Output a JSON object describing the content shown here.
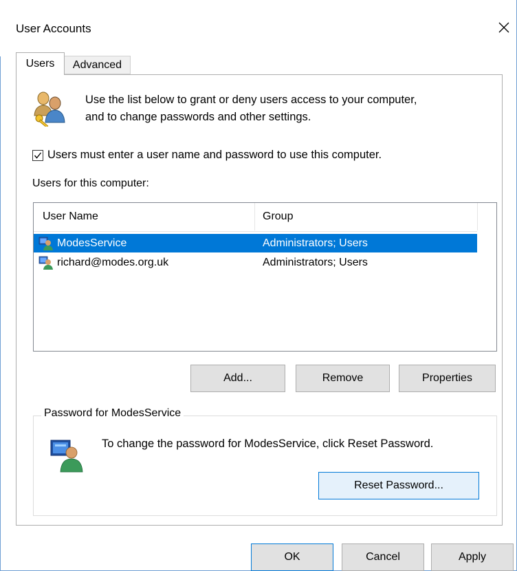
{
  "window": {
    "title": "User Accounts"
  },
  "tabs": [
    {
      "label": "Users",
      "active": true
    },
    {
      "label": "Advanced",
      "active": false
    }
  ],
  "intro": {
    "line1": "Use the list below to grant or deny users access to your computer,",
    "line2": "and to change passwords and other settings."
  },
  "require_login": {
    "label": "Users must enter a user name and password to use this computer.",
    "checked": true
  },
  "users_list": {
    "label": "Users for this computer:",
    "columns": [
      "User Name",
      "Group"
    ],
    "rows": [
      {
        "name": "ModesService",
        "group": "Administrators; Users",
        "selected": true
      },
      {
        "name": "richard@modes.org.uk",
        "group": "Administrators; Users",
        "selected": false
      }
    ]
  },
  "list_buttons": {
    "add": "Add...",
    "remove": "Remove",
    "properties": "Properties"
  },
  "password_group": {
    "legend": "Password for ModesService",
    "text": "To change the password for ModesService, click Reset Password.",
    "reset_button": "Reset Password..."
  },
  "dialog_buttons": {
    "ok": "OK",
    "cancel": "Cancel",
    "apply": "Apply"
  },
  "colors": {
    "selection": "#0078d7",
    "border_accent": "#6e9ed3",
    "button_face": "#e1e1e1"
  },
  "icons": {
    "users": "users-key-icon",
    "user_row": "user-icon",
    "password": "user-password-icon",
    "close": "close-icon"
  }
}
